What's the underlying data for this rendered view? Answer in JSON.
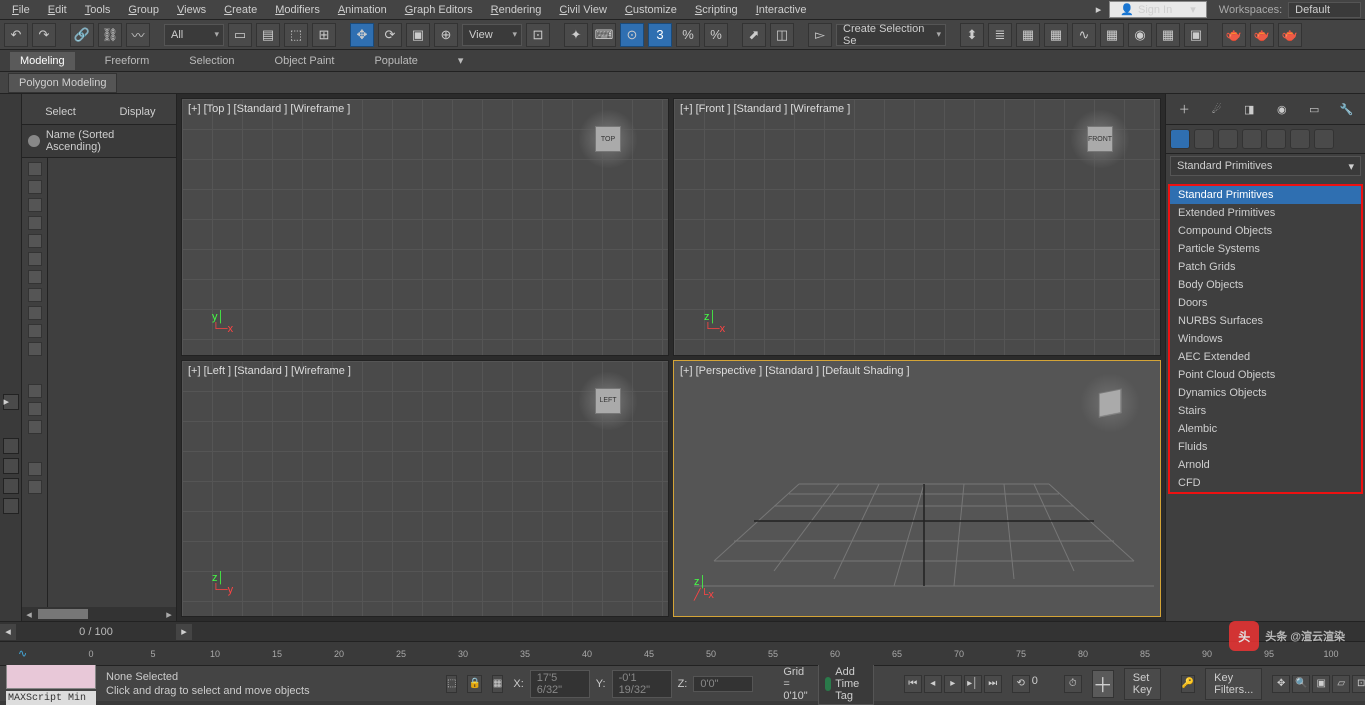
{
  "menu": [
    "File",
    "Edit",
    "Tools",
    "Group",
    "Views",
    "Create",
    "Modifiers",
    "Animation",
    "Graph Editors",
    "Rendering",
    "Civil View",
    "Customize",
    "Scripting",
    "Interactive"
  ],
  "signin": "Sign In",
  "workspaces_label": "Workspaces:",
  "workspaces_value": "Default",
  "toolbar": {
    "all": "All",
    "view": "View",
    "selset": "Create Selection Se"
  },
  "ribbon": [
    "Modeling",
    "Freeform",
    "Selection",
    "Object Paint",
    "Populate"
  ],
  "subribbon": "Polygon Modeling",
  "scene": {
    "tabs": [
      "Select",
      "Display"
    ],
    "header": "Name (Sorted Ascending)"
  },
  "viewports": {
    "top": "[+] [Top ] [Standard ] [Wireframe ]",
    "front": "[+] [Front ] [Standard ] [Wireframe ]",
    "left": "[+] [Left ] [Standard ] [Wireframe ]",
    "persp": "[+] [Perspective ] [Standard ] [Default Shading ]",
    "cube_top": "TOP",
    "cube_front": "FRONT",
    "cube_left": "LEFT"
  },
  "cmd": {
    "dropdown": "Standard Primitives",
    "list": [
      "Standard Primitives",
      "Extended Primitives",
      "Compound Objects",
      "Particle Systems",
      "Patch Grids",
      "Body Objects",
      "Doors",
      "NURBS Surfaces",
      "Windows",
      "AEC Extended",
      "Point Cloud Objects",
      "Dynamics Objects",
      "Stairs",
      "Alembic",
      "Fluids",
      "Arnold",
      "CFD"
    ]
  },
  "timeline": {
    "page": "0 / 100",
    "ticks": [
      "0",
      "5",
      "10",
      "15",
      "20",
      "25",
      "30",
      "35",
      "40",
      "45",
      "50",
      "55",
      "60",
      "65",
      "70",
      "75",
      "80",
      "85",
      "90",
      "95",
      "100"
    ]
  },
  "status": {
    "maxscript": "MAXScript Min",
    "none": "None Selected",
    "hint": "Click and drag to select and move objects",
    "x_lbl": "X:",
    "x": "17'5 6/32\"",
    "y_lbl": "Y:",
    "y": "-0'1 19/32\"",
    "z_lbl": "Z:",
    "z": "0'0\"",
    "grid": "Grid = 0'10\"",
    "addtag": "Add Time Tag",
    "spin": "0",
    "setkey": "Set Key",
    "keyfilters": "Key Filters..."
  },
  "watermark": "头条 @渲云渲染"
}
